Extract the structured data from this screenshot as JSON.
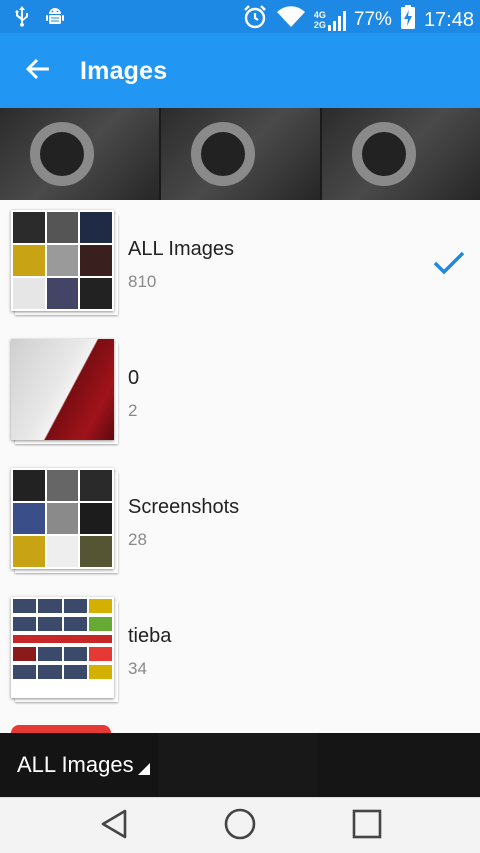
{
  "status_bar": {
    "battery_percent": "77%",
    "time": "17:48",
    "network_top": "4G",
    "network_bottom": "2G",
    "icons": [
      "usb-icon",
      "android-debug-icon",
      "alarm-icon",
      "wifi-icon",
      "signal-icon",
      "battery-charging-icon"
    ]
  },
  "app_bar": {
    "title": "Images",
    "back_icon": "arrow-back-icon"
  },
  "folders": [
    {
      "name": "ALL Images",
      "count": "810",
      "selected": true
    },
    {
      "name": "0",
      "count": "2",
      "selected": false
    },
    {
      "name": "Screenshots",
      "count": "28",
      "selected": false
    },
    {
      "name": "tieba",
      "count": "34",
      "selected": false
    }
  ],
  "album_selector": {
    "label": "ALL Images"
  },
  "nav_bar": {
    "buttons": [
      "back-triangle-icon",
      "home-circle-icon",
      "recents-square-icon"
    ]
  },
  "colors": {
    "status_bar": "#1e88e5",
    "app_bar": "#2196f3",
    "check": "#1e88e5",
    "list_bg": "#fafafa",
    "count_text": "#8a8a8a"
  }
}
